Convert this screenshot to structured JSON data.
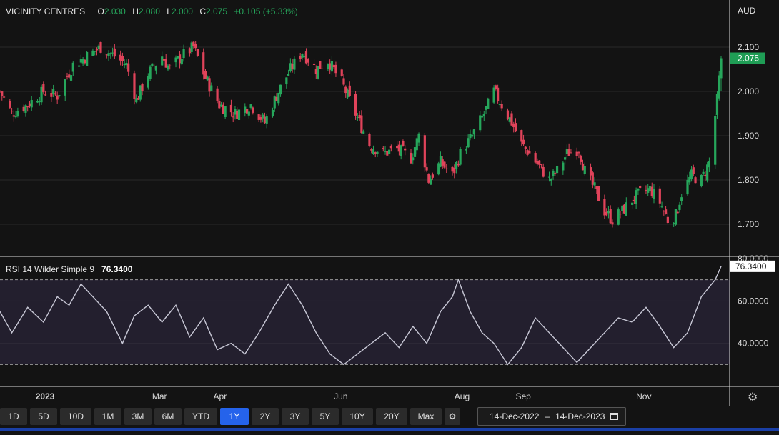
{
  "header": {
    "symbol": "VICINITY CENTRES",
    "open_label": "O",
    "open": "2.030",
    "high_label": "H",
    "high": "2.080",
    "low_label": "L",
    "low": "2.000",
    "close_label": "C",
    "close": "2.075",
    "change": "+0.105 (+5.33%)"
  },
  "currency": "AUD",
  "rsi": {
    "label": "RSI 14 Wilder Simple 9",
    "value": "76.3400"
  },
  "price_badge": "2.075",
  "rsi_badge": "76.3400",
  "toolbar": {
    "ranges": [
      "1D",
      "5D",
      "10D",
      "1M",
      "3M",
      "6M",
      "YTD",
      "1Y",
      "2Y",
      "3Y",
      "5Y",
      "10Y",
      "20Y",
      "Max"
    ],
    "active": "1Y",
    "settings_icon": "gear-icon"
  },
  "date_range": {
    "start": "14-Dec-2022",
    "sep": "–",
    "end": "14-Dec-2023",
    "icon": "calendar-icon"
  },
  "colors": {
    "up": "#26a65b",
    "down": "#e0435a",
    "rsi_line": "#c8c8d6",
    "rsi_band": "#231f2e",
    "badge_green": "#1f9d55",
    "active_button": "#2563eb"
  },
  "chart_data": [
    {
      "type": "candlestick",
      "title": "VICINITY CENTRES",
      "ylim": [
        1.65,
        2.15
      ],
      "yticks": [
        1.7,
        1.8,
        1.9,
        2.0,
        2.1
      ],
      "ytick_labels": [
        "1.700",
        "1.800",
        "1.900",
        "2.000",
        "2.100"
      ],
      "xlim": [
        "2022-12-14",
        "2023-12-14"
      ],
      "xtick_dates": [
        "2023-01-01",
        "2023-03-01",
        "2023-04-01",
        "2023-06-01",
        "2023-08-01",
        "2023-09-01",
        "2023-11-01"
      ],
      "xtick_labels": [
        "2023",
        "Mar",
        "Apr",
        "Jun",
        "Aug",
        "Sep",
        "Nov"
      ],
      "close_anchors": [
        [
          "2022-12-14",
          2.0
        ],
        [
          "2022-12-20",
          1.95
        ],
        [
          "2022-12-28",
          1.97
        ],
        [
          "2023-01-05",
          2.0
        ],
        [
          "2023-01-12",
          1.99
        ],
        [
          "2023-01-20",
          2.06
        ],
        [
          "2023-01-27",
          2.08
        ],
        [
          "2023-02-03",
          2.1
        ],
        [
          "2023-02-10",
          2.08
        ],
        [
          "2023-02-16",
          2.06
        ],
        [
          "2023-02-21",
          1.98
        ],
        [
          "2023-02-27",
          2.04
        ],
        [
          "2023-03-06",
          2.08
        ],
        [
          "2023-03-10",
          2.05
        ],
        [
          "2023-03-16",
          2.08
        ],
        [
          "2023-03-22",
          2.1
        ],
        [
          "2023-03-28",
          2.03
        ],
        [
          "2023-04-04",
          1.97
        ],
        [
          "2023-04-12",
          1.95
        ],
        [
          "2023-04-20",
          1.97
        ],
        [
          "2023-04-27",
          1.93
        ],
        [
          "2023-05-04",
          2.0
        ],
        [
          "2023-05-10",
          2.05
        ],
        [
          "2023-05-16",
          2.09
        ],
        [
          "2023-05-23",
          2.05
        ],
        [
          "2023-05-29",
          2.07
        ],
        [
          "2023-06-05",
          2.02
        ],
        [
          "2023-06-12",
          1.95
        ],
        [
          "2023-06-19",
          1.88
        ],
        [
          "2023-06-26",
          1.86
        ],
        [
          "2023-07-03",
          1.87
        ],
        [
          "2023-07-10",
          1.85
        ],
        [
          "2023-07-14",
          1.9
        ],
        [
          "2023-07-19",
          1.8
        ],
        [
          "2023-07-25",
          1.84
        ],
        [
          "2023-07-31",
          1.81
        ],
        [
          "2023-08-04",
          1.86
        ],
        [
          "2023-08-10",
          1.9
        ],
        [
          "2023-08-16",
          1.95
        ],
        [
          "2023-08-21",
          2.0
        ],
        [
          "2023-08-25",
          1.97
        ],
        [
          "2023-08-30",
          1.93
        ],
        [
          "2023-09-04",
          1.88
        ],
        [
          "2023-09-08",
          1.86
        ],
        [
          "2023-09-13",
          1.83
        ],
        [
          "2023-09-18",
          1.8
        ],
        [
          "2023-09-22",
          1.82
        ],
        [
          "2023-09-27",
          1.86
        ],
        [
          "2023-10-03",
          1.87
        ],
        [
          "2023-10-06",
          1.82
        ],
        [
          "2023-10-11",
          1.78
        ],
        [
          "2023-10-16",
          1.73
        ],
        [
          "2023-10-20",
          1.71
        ],
        [
          "2023-10-25",
          1.73
        ],
        [
          "2023-10-31",
          1.76
        ],
        [
          "2023-11-03",
          1.77
        ],
        [
          "2023-11-08",
          1.78
        ],
        [
          "2023-11-13",
          1.75
        ],
        [
          "2023-11-17",
          1.71
        ],
        [
          "2023-11-21",
          1.72
        ],
        [
          "2023-11-24",
          1.77
        ],
        [
          "2023-11-29",
          1.81
        ],
        [
          "2023-12-04",
          1.8
        ],
        [
          "2023-12-08",
          1.84
        ],
        [
          "2023-12-12",
          1.98
        ],
        [
          "2023-12-14",
          2.075
        ]
      ]
    },
    {
      "type": "line",
      "title": "RSI 14 Wilder Simple 9",
      "ylim": [
        20,
        80
      ],
      "yticks": [
        40,
        60,
        80
      ],
      "ytick_labels": [
        "40.0000",
        "60.0000",
        "80.0000"
      ],
      "reference_lines": [
        70,
        30
      ],
      "xlim": [
        "2022-12-14",
        "2023-12-14"
      ],
      "series": [
        {
          "x": [
            "2022-12-14",
            "2022-12-20",
            "2022-12-28",
            "2023-01-05",
            "2023-01-12",
            "2023-01-18",
            "2023-01-24",
            "2023-01-30",
            "2023-02-06",
            "2023-02-14",
            "2023-02-20",
            "2023-02-27",
            "2023-03-06",
            "2023-03-13",
            "2023-03-20",
            "2023-03-27",
            "2023-04-03",
            "2023-04-10",
            "2023-04-17",
            "2023-04-24",
            "2023-05-02",
            "2023-05-09",
            "2023-05-16",
            "2023-05-23",
            "2023-05-30",
            "2023-06-06",
            "2023-06-13",
            "2023-06-20",
            "2023-06-27",
            "2023-07-04",
            "2023-07-11",
            "2023-07-18",
            "2023-07-25",
            "2023-07-31",
            "2023-08-03",
            "2023-08-09",
            "2023-08-15",
            "2023-08-21",
            "2023-08-28",
            "2023-09-04",
            "2023-09-11",
            "2023-09-18",
            "2023-09-25",
            "2023-10-02",
            "2023-10-09",
            "2023-10-16",
            "2023-10-23",
            "2023-10-30",
            "2023-11-06",
            "2023-11-13",
            "2023-11-20",
            "2023-11-27",
            "2023-12-04",
            "2023-12-11",
            "2023-12-14"
          ],
          "values": [
            55,
            45,
            57,
            50,
            62,
            58,
            68,
            62,
            55,
            40,
            53,
            58,
            50,
            58,
            43,
            52,
            37,
            40,
            35,
            45,
            58,
            68,
            58,
            45,
            35,
            30,
            35,
            40,
            45,
            38,
            48,
            40,
            55,
            62,
            70,
            55,
            45,
            40,
            30,
            38,
            52,
            45,
            38,
            31,
            38,
            45,
            52,
            50,
            57,
            48,
            38,
            45,
            62,
            70,
            76.34
          ]
        }
      ]
    }
  ]
}
